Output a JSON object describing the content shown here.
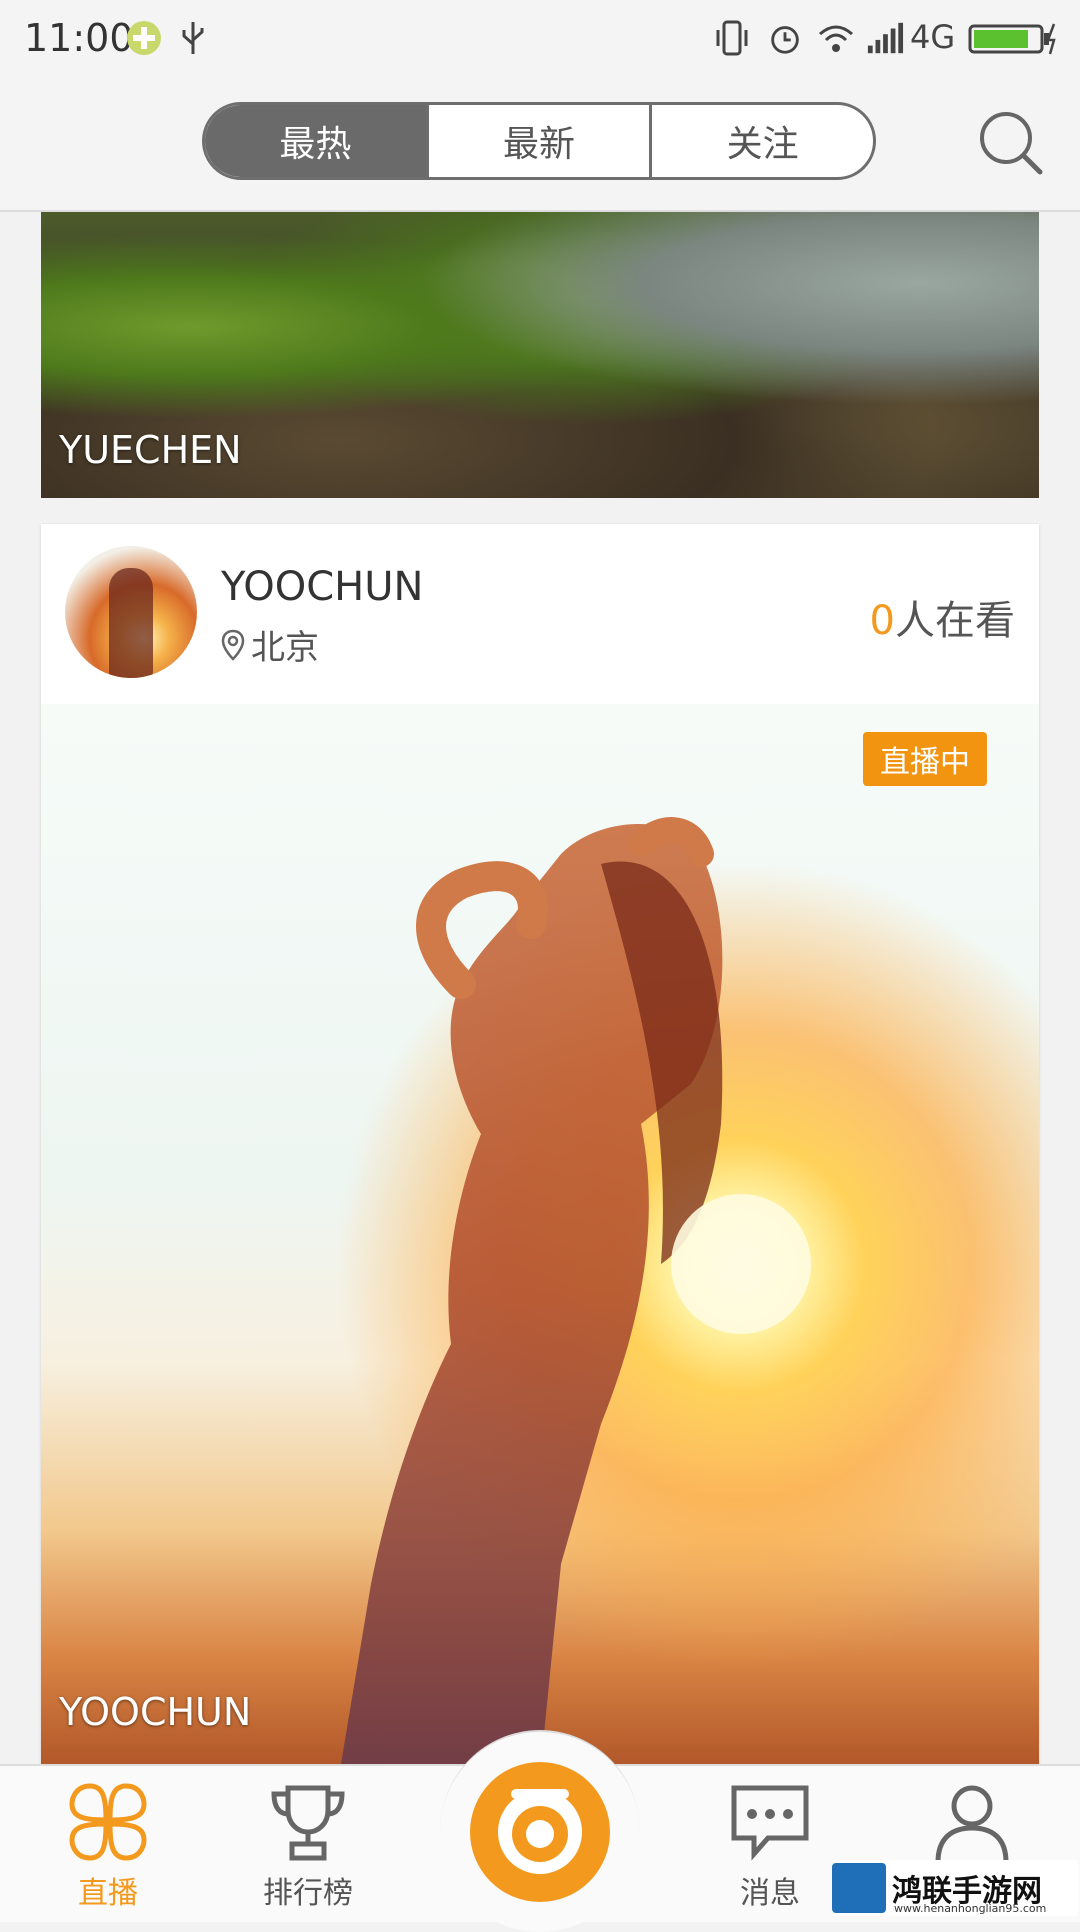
{
  "status_bar": {
    "time": "11:00",
    "network": "4G"
  },
  "top_nav": {
    "tabs": [
      {
        "label": "最热",
        "active": true
      },
      {
        "label": "最新",
        "active": false
      },
      {
        "label": "关注",
        "active": false
      }
    ],
    "search_icon": "search-icon"
  },
  "feed": {
    "previous_card": {
      "name_overlay": "YUECHEN"
    },
    "live_card": {
      "user_name": "YOOCHUN",
      "location": "北京",
      "viewer_count": "0",
      "viewer_suffix": "人在看",
      "live_badge": "直播中",
      "name_overlay": "YOOCHUN"
    }
  },
  "bottom_nav": {
    "items": [
      {
        "label": "直播",
        "icon": "clover-icon",
        "active": true
      },
      {
        "label": "排行榜",
        "icon": "trophy-icon",
        "active": false
      },
      {
        "label": "",
        "icon": "camera-icon",
        "active": false
      },
      {
        "label": "消息",
        "icon": "message-icon",
        "active": false
      },
      {
        "label": "",
        "icon": "profile-icon",
        "active": false
      }
    ]
  },
  "watermark": {
    "title": "鸿联手游网",
    "url": "www.henanhonglian95.com"
  },
  "colors": {
    "accent": "#f39a1e",
    "segment_active": "#6a6a6a"
  }
}
